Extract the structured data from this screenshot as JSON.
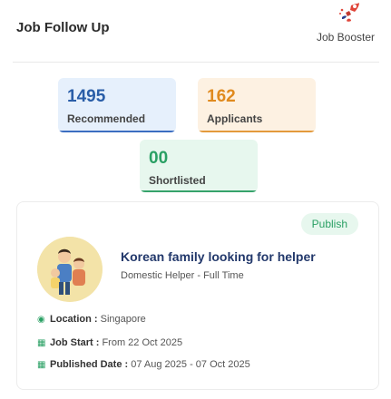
{
  "header": {
    "title": "Job Follow Up",
    "booster_label": "Job Booster",
    "booster_icon": "rocket-icon"
  },
  "stats": {
    "recommended": {
      "value": "1495",
      "label": "Recommended",
      "color": "#3b6dc1"
    },
    "applicants": {
      "value": "162",
      "label": "Applicants",
      "color": "#e39a3c"
    },
    "shortlisted": {
      "value": "00",
      "label": "Shortlisted",
      "color": "#36a36b"
    }
  },
  "job": {
    "status": "Publish",
    "title": "Korean family looking for helper",
    "subtitle": "Domestic Helper - Full Time",
    "location_label": "Location :",
    "location_value": " Singapore",
    "start_label": "Job Start :",
    "start_value": " From 22 Oct 2025",
    "published_label": "Published Date :",
    "published_value": " 07 Aug 2025 - 07 Oct 2025"
  }
}
